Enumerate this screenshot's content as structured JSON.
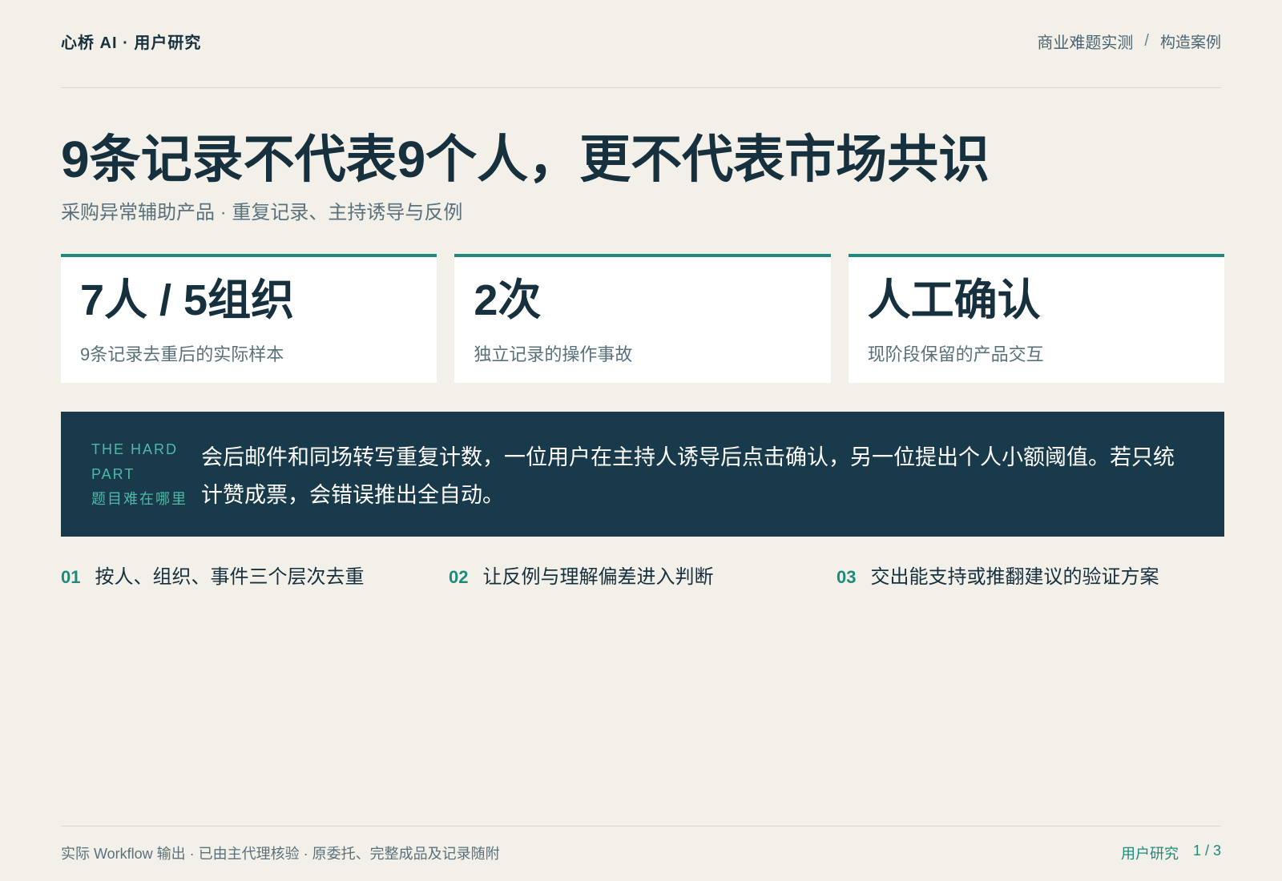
{
  "header": {
    "brand": "心桥 AI · 用户研究",
    "crumb_main": "商业难题实测",
    "crumb_sep": "/",
    "crumb_sub": "构造案例"
  },
  "title": "9条记录不代表9个人，更不代表市场共识",
  "subtitle": "采购异常辅助产品 · 重复记录、主持诱导与反例",
  "stats": [
    {
      "value": "7人 / 5组织",
      "label": "9条记录去重后的实际样本"
    },
    {
      "value": "2次",
      "label": "独立记录的操作事故"
    },
    {
      "value": "人工确认",
      "label": "现阶段保留的产品交互"
    }
  ],
  "hard_part": {
    "tag_en_1": "THE HARD",
    "tag_en_2": "PART",
    "tag_zh": "题目难在哪里",
    "text": "会后邮件和同场转写重复计数，一位用户在主持人诱导后点击确认，另一位提出个人小额阈值。若只统计赞成票，会错误推出全自动。"
  },
  "steps": [
    {
      "num": "01",
      "text": "按人、组织、事件三个层次去重"
    },
    {
      "num": "02",
      "text": "让反例与理解偏差进入判断"
    },
    {
      "num": "03",
      "text": "交出能支持或推翻建议的验证方案"
    }
  ],
  "footer": {
    "left": "实际 Workflow 输出 · 已由主代理核验 · 原委托、完整成品及记录随附",
    "section": "用户研究",
    "page": "1 / 3"
  },
  "colors": {
    "background": "#f3f0ea",
    "accent": "#1f8a7c",
    "dark_panel": "#183a4b",
    "text": "#17303d"
  }
}
